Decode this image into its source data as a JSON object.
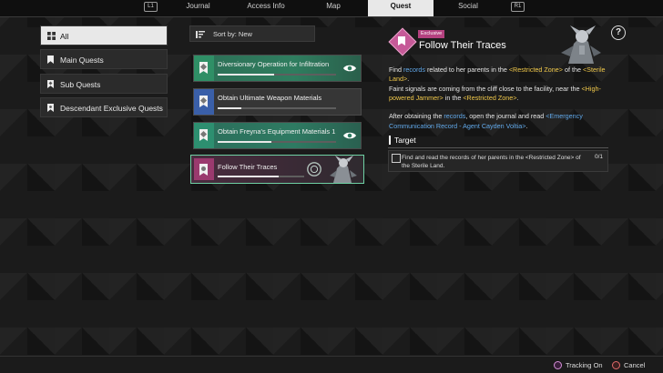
{
  "tabs": {
    "left_key": "L1",
    "right_key": "R1",
    "items": [
      {
        "label": "Journal"
      },
      {
        "label": "Access Info"
      },
      {
        "label": "Map"
      },
      {
        "label": "Quest"
      },
      {
        "label": "Social"
      }
    ],
    "active": "Quest"
  },
  "categories": [
    {
      "label": "All",
      "active": true
    },
    {
      "label": "Main Quests"
    },
    {
      "label": "Sub Quests"
    },
    {
      "label": "Descendant Exclusive Quests"
    }
  ],
  "sort": {
    "label": "Sort by: New"
  },
  "quests": [
    {
      "title": "Diversionary Operation for Infiltration",
      "progress": 0.48,
      "tracked": true,
      "stripe_color": "#2f8f66",
      "bg": "#2e7a5d"
    },
    {
      "title": "Obtain Ultimate Weapon Materials",
      "progress": 0.2,
      "tracked": false,
      "stripe_color": "#3a5fa8",
      "bg": "#3a3a3a"
    },
    {
      "title": "Obtain Freyna's Equipment Materials 1",
      "progress": 0.45,
      "tracked": true,
      "stripe_color": "#2d8f70",
      "bg": "#2d7a62"
    },
    {
      "title": "Follow Their Traces",
      "progress": 0.7,
      "tracked": false,
      "stripe_color": "#9a3a6e",
      "bg": "#3a2835",
      "selected": true
    }
  ],
  "detail": {
    "badge": "Exclusive",
    "title": "Follow Their Traces",
    "desc": {
      "p1_a": "Find ",
      "p1_records": "records",
      "p1_b": " related to her parents in the ",
      "p1_zone": "<Restricted Zone>",
      "p1_c": " of the ",
      "p1_land": "<Sterile Land>",
      "p1_d": ".",
      "p2_a": "Faint signals are coming from the cliff close to the facility, near the ",
      "p2_jammer": "<High-powered Jammer>",
      "p2_b": " in the ",
      "p2_zone": "<Restricted Zone>",
      "p2_c": ".",
      "p3_a": "After obtaining the ",
      "p3_records": "records",
      "p3_b": ", open the journal and read ",
      "p3_comm": "<Emergency Communication Record - Agent Cayden Voltia>",
      "p3_c": "."
    },
    "target_heading": "Target",
    "target": {
      "text": "Find and read the records of her parents in the <Restricted Zone> of the Sterile Land.",
      "count": "0/1"
    }
  },
  "bottom": {
    "tracking": "Tracking On",
    "cancel": "Cancel"
  },
  "colors": {
    "accent_blue": "#62a9ea",
    "accent_yellow": "#f0c84a",
    "exclusive_pink": "#b4417f"
  }
}
